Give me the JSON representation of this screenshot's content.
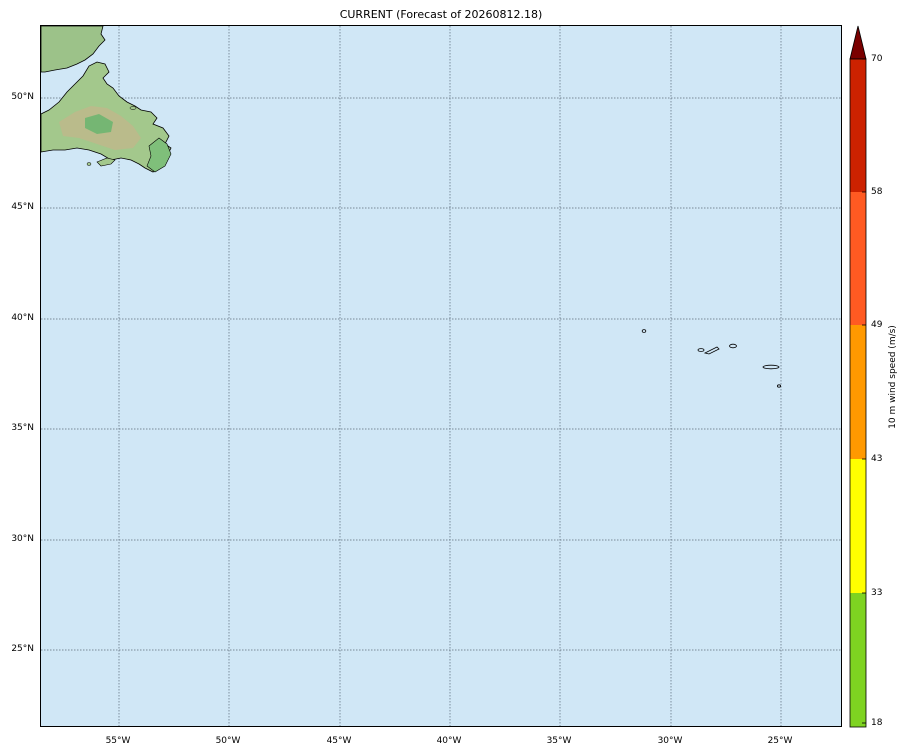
{
  "map": {
    "title": "CURRENT (Forecast of 20260812.18)",
    "lon_labels": [
      "55°W",
      "50°W",
      "45°W",
      "40°W",
      "35°W",
      "30°W",
      "25°W"
    ],
    "lat_labels": [
      "50°N",
      "45°N",
      "40°N",
      "35°N",
      "30°N",
      "25°N"
    ],
    "ocean_color": "#d0e7f6",
    "land_color": "#a6c48e"
  },
  "colorbar": {
    "title": "10 m wind speed (m/s)",
    "ticks": [
      "18",
      "33",
      "43",
      "49",
      "58",
      "70"
    ],
    "colors": [
      "#7ed321",
      "#ffff00",
      "#ff9900",
      "#ff5a22",
      "#cc2200",
      "#7a0000"
    ]
  }
}
